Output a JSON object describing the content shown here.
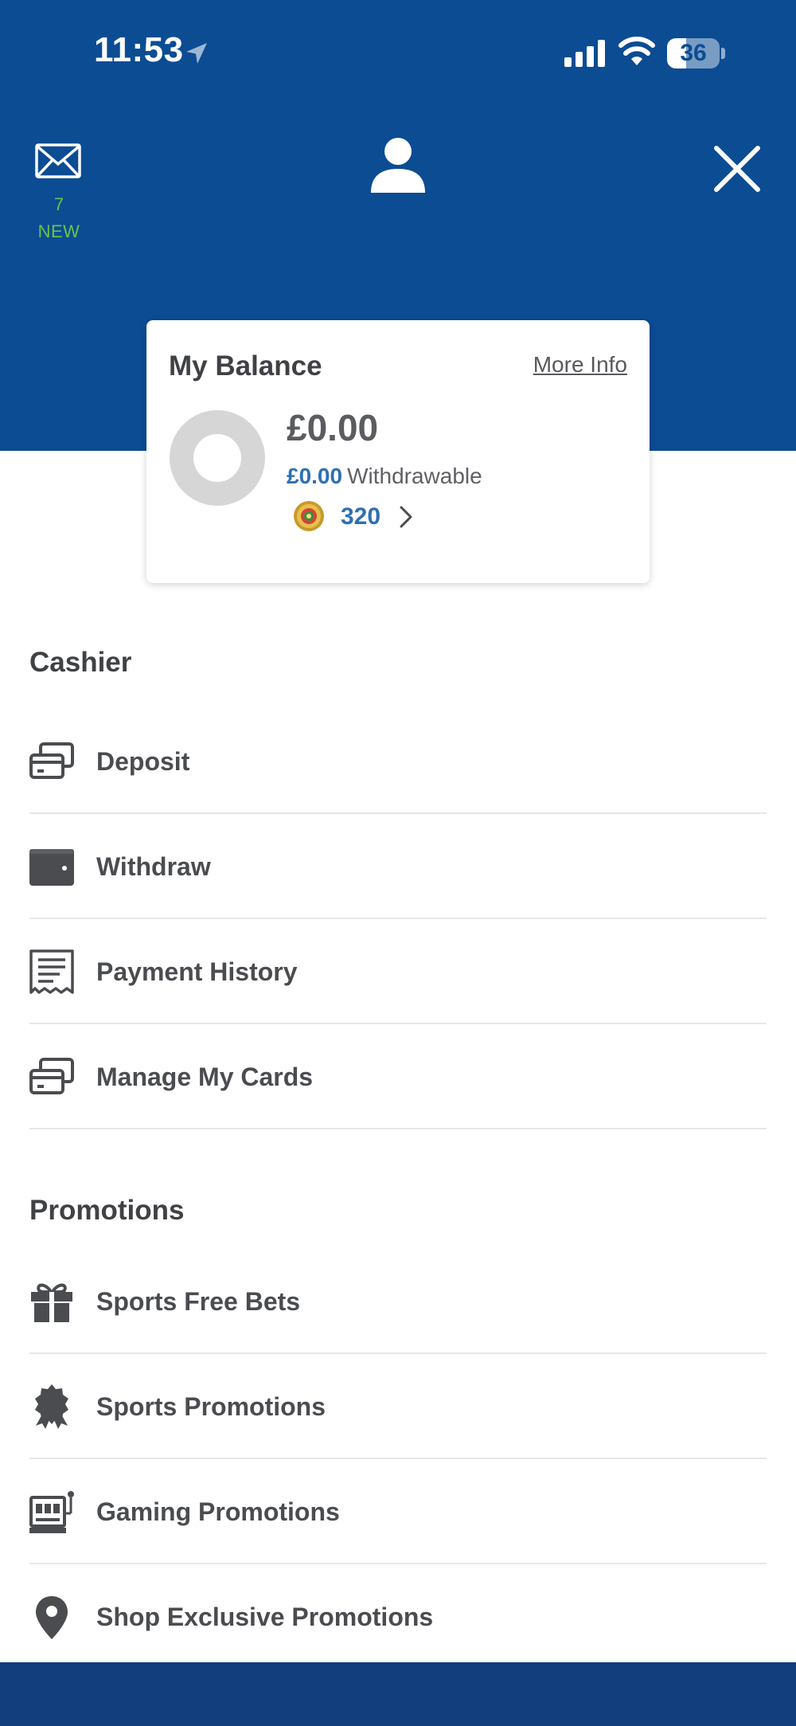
{
  "status_bar": {
    "time": "11:53",
    "battery": "36",
    "battery_level": 0.36
  },
  "header": {
    "mail_count": "7",
    "mail_new_label": "NEW",
    "icons": [
      "envelope-icon",
      "user-icon",
      "close-icon"
    ],
    "background_color": "#0b4c93",
    "accent_green": "#6dc24b"
  },
  "balance_card": {
    "title": "My Balance",
    "more_info": "More Info",
    "amount": "£0.00",
    "withdrawable_amount": "£0.00",
    "withdrawable_label": "Withdrawable",
    "points": "320"
  },
  "cashier": {
    "title": "Cashier",
    "items": [
      {
        "label": "Deposit",
        "icon": "cards-icon"
      },
      {
        "label": "Withdraw",
        "icon": "wallet-icon"
      },
      {
        "label": "Payment History",
        "icon": "receipt-icon"
      },
      {
        "label": "Manage My Cards",
        "icon": "cards-icon"
      }
    ]
  },
  "promotions": {
    "title": "Promotions",
    "items": [
      {
        "label": "Sports Free Bets",
        "icon": "gift-icon"
      },
      {
        "label": "Sports Promotions",
        "icon": "award-badge-icon"
      },
      {
        "label": "Gaming Promotions",
        "icon": "slot-machine-icon"
      },
      {
        "label": "Shop Exclusive Promotions",
        "icon": "map-pin-icon"
      }
    ]
  }
}
